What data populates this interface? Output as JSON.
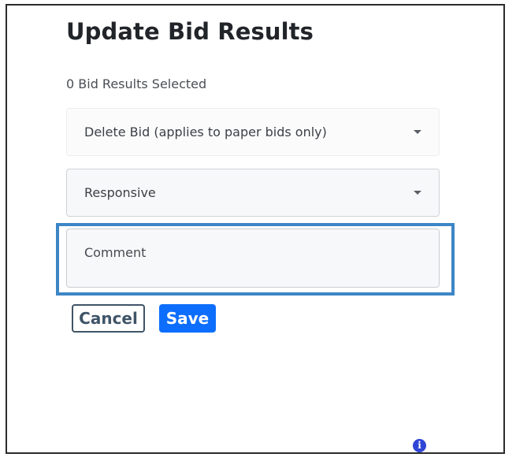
{
  "dialog": {
    "title": "Update Bid Results",
    "selected_count": "0 Bid Results Selected"
  },
  "fields": {
    "action_select": {
      "value": "Delete Bid (applies to paper bids only)"
    },
    "status_select": {
      "value": "Responsive"
    },
    "comment": {
      "placeholder": "Comment"
    }
  },
  "buttons": {
    "cancel_label": "Cancel",
    "save_label": "Save"
  },
  "icons": {
    "info": {
      "name": "info-icon",
      "glyph": "i",
      "color": "#2f45d6"
    }
  },
  "colors": {
    "primary": "#0d6efd",
    "cancel_border": "#3f5467",
    "focus_ring": "#3d86c6"
  }
}
